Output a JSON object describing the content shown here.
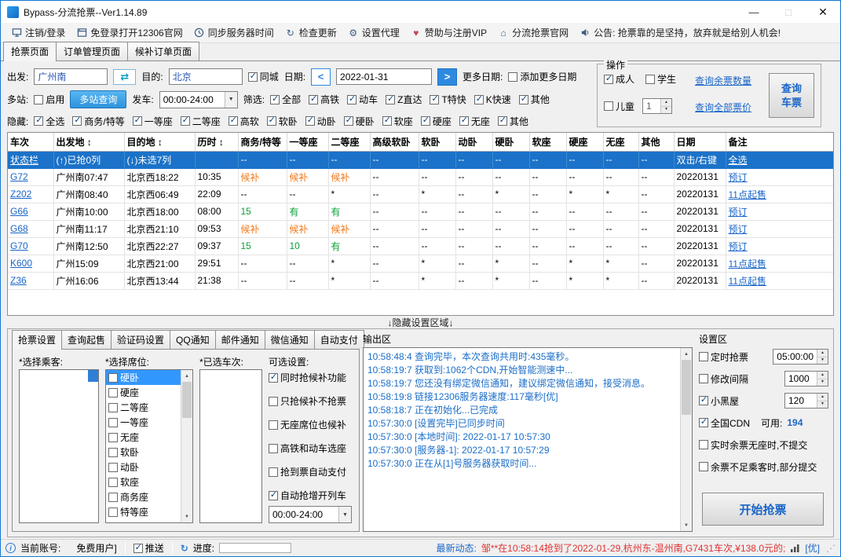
{
  "window": {
    "title": "Bypass-分流抢票--Ver1.14.89",
    "minimize": "—",
    "maximize": "□",
    "close": "✕"
  },
  "icons": {
    "swap": "⇄",
    "refresh": "↻",
    "proxy": "⚙",
    "heart": "♥",
    "home": "⌂",
    "progress": "↻",
    "info": "i",
    "date_prev": "<",
    "date_next": ">",
    "dropdown": "▼",
    "up": "▲",
    "down": "▼",
    "grip": "⋰"
  },
  "menubar": {
    "items": [
      {
        "icon": "computer-icon",
        "label": "注销/登录"
      },
      {
        "icon": "browser-icon",
        "label": "免登录打开12306官网"
      },
      {
        "icon": "clock-icon",
        "label": "同步服务器时间"
      },
      {
        "icon": "refresh-icon",
        "label": "检查更新"
      },
      {
        "icon": "proxy-icon",
        "label": "设置代理"
      },
      {
        "icon": "heart-icon",
        "label": "赞助与注册VIP"
      },
      {
        "icon": "home-icon",
        "label": "分流抢票官网"
      },
      {
        "icon": "announce-icon",
        "label": "公告: 抢票靠的是坚持，放弃就是给别人机会!"
      }
    ]
  },
  "main_tabs": [
    {
      "label": "抢票页面",
      "active": true
    },
    {
      "label": "订单管理页面",
      "active": false
    },
    {
      "label": "候补订单页面",
      "active": false
    }
  ],
  "query": {
    "depart_label": "出发:",
    "depart_value": "广州南",
    "dest_label": "目的:",
    "dest_value": "北京",
    "same_city": {
      "label": "同城",
      "checked": true
    },
    "date_label": "日期:",
    "date_value": "2022-01-31",
    "more_dates_label": "更多日期:",
    "add_more_dates": {
      "label": "添加更多日期",
      "checked": false
    },
    "multi_label": "多站:",
    "multi_enable": {
      "label": "启用",
      "checked": false
    },
    "multi_query_button": "多站查询",
    "depart_time_label": "发车:",
    "depart_time_value": "00:00-24:00",
    "filter_label": "筛选:",
    "filters": [
      {
        "label": "全部",
        "checked": true
      },
      {
        "label": "高铁",
        "checked": true
      },
      {
        "label": "动车",
        "checked": true
      },
      {
        "label": "Z直达",
        "checked": true
      },
      {
        "label": "T特快",
        "checked": true
      },
      {
        "label": "K快速",
        "checked": true
      },
      {
        "label": "其他",
        "checked": true
      }
    ],
    "hide_label": "隐藏:",
    "hide_options": [
      {
        "label": "全选",
        "checked": true
      },
      {
        "label": "商务/特等",
        "checked": true
      },
      {
        "label": "一等座",
        "checked": true
      },
      {
        "label": "二等座",
        "checked": true
      },
      {
        "label": "高软",
        "checked": true
      },
      {
        "label": "软卧",
        "checked": true
      },
      {
        "label": "动卧",
        "checked": true
      },
      {
        "label": "硬卧",
        "checked": true
      },
      {
        "label": "软座",
        "checked": true
      },
      {
        "label": "硬座",
        "checked": true
      },
      {
        "label": "无座",
        "checked": true
      },
      {
        "label": "其他",
        "checked": true
      }
    ]
  },
  "operation": {
    "group_label": "操作",
    "adult": {
      "label": "成人",
      "checked": true
    },
    "student": {
      "label": "学生",
      "checked": false
    },
    "child": {
      "label": "儿童",
      "checked": false
    },
    "child_count": "1",
    "link_query_count": "查询余票数量",
    "link_query_price": "查询全部票价",
    "query_button_line1": "查询",
    "query_button_line2": "车票"
  },
  "train_table": {
    "columns": [
      "车次",
      "出发地 ↕",
      "目的地 ↕",
      "历时 ↕",
      "商务/特等",
      "一等座",
      "二等座",
      "高级软卧",
      "软卧",
      "动卧",
      "硬卧",
      "软座",
      "硬座",
      "无座",
      "其他",
      "日期",
      "备注"
    ],
    "status_row": [
      [
        "状态栏",
        "wlink"
      ],
      "(↑)已抢0列",
      "(↓)未选7列",
      "",
      "--",
      "--",
      "--",
      "--",
      "--",
      "--",
      "--",
      "--",
      "--",
      "--",
      "--",
      "双击/右键",
      [
        "全选",
        "wlink"
      ]
    ],
    "rows": [
      [
        [
          "G72",
          "link"
        ],
        "广州南07:47",
        "北京西18:22",
        "10:35",
        [
          "候补",
          "wait"
        ],
        [
          "候补",
          "wait"
        ],
        [
          "候补",
          "wait"
        ],
        "--",
        "--",
        "--",
        "--",
        "--",
        "--",
        "--",
        "--",
        "20220131",
        [
          "预订",
          "link"
        ]
      ],
      [
        [
          "Z202",
          "link"
        ],
        "广州南08:40",
        "北京西06:49",
        "22:09",
        "--",
        "--",
        "*",
        "--",
        "*",
        "--",
        "*",
        "--",
        "*",
        "*",
        "--",
        "20220131",
        [
          "11点起售",
          "link"
        ]
      ],
      [
        [
          "G66",
          "link"
        ],
        "广州南10:00",
        "北京西18:00",
        "08:00",
        [
          "15",
          "ok"
        ],
        [
          "有",
          "ok"
        ],
        [
          "有",
          "ok"
        ],
        "--",
        "--",
        "--",
        "--",
        "--",
        "--",
        "--",
        "--",
        "20220131",
        [
          "预订",
          "link"
        ]
      ],
      [
        [
          "G68",
          "link"
        ],
        "广州南11:17",
        "北京西21:10",
        "09:53",
        [
          "候补",
          "wait"
        ],
        [
          "候补",
          "wait"
        ],
        [
          "候补",
          "wait"
        ],
        "--",
        "--",
        "--",
        "--",
        "--",
        "--",
        "--",
        "--",
        "20220131",
        [
          "预订",
          "link"
        ]
      ],
      [
        [
          "G70",
          "link"
        ],
        "广州南12:50",
        "北京西22:27",
        "09:37",
        [
          "15",
          "ok"
        ],
        [
          "10",
          "ok"
        ],
        [
          "有",
          "ok"
        ],
        "--",
        "--",
        "--",
        "--",
        "--",
        "--",
        "--",
        "--",
        "20220131",
        [
          "预订",
          "link"
        ]
      ],
      [
        [
          "K600",
          "link"
        ],
        "广州15:09",
        "北京西21:00",
        "29:51",
        "--",
        "--",
        "*",
        "--",
        "*",
        "--",
        "*",
        "--",
        "*",
        "*",
        "--",
        "20220131",
        [
          "11点起售",
          "link"
        ]
      ],
      [
        [
          "Z36",
          "link"
        ],
        "广州16:06",
        "北京西13:44",
        "21:38",
        "--",
        "--",
        "*",
        "--",
        "*",
        "--",
        "*",
        "--",
        "*",
        "*",
        "--",
        "20220131",
        [
          "11点起售",
          "link"
        ]
      ]
    ]
  },
  "hide_divider": "↓隐藏设置区域↓",
  "grab_settings": {
    "tabs": [
      {
        "label": "抢票设置",
        "active": true
      },
      {
        "label": "查询起售",
        "active": false
      },
      {
        "label": "验证码设置",
        "active": false
      },
      {
        "label": "QQ通知",
        "active": false
      },
      {
        "label": "邮件通知",
        "active": false
      },
      {
        "label": "微信通知",
        "active": false
      },
      {
        "label": "自动支付",
        "active": false
      }
    ],
    "passengers_label": "*选择乘客:",
    "seats_label": "*选择席位:",
    "trains_label": "*已选车次:",
    "options_label": "可选设置:",
    "seats": [
      {
        "label": "硬卧",
        "checked": false,
        "selected": true
      },
      {
        "label": "硬座",
        "checked": false
      },
      {
        "label": "二等座",
        "checked": false
      },
      {
        "label": "一等座",
        "checked": false
      },
      {
        "label": "无座",
        "checked": false
      },
      {
        "label": "软卧",
        "checked": false
      },
      {
        "label": "动卧",
        "checked": false
      },
      {
        "label": "软座",
        "checked": false
      },
      {
        "label": "商务座",
        "checked": false
      },
      {
        "label": "特等座",
        "checked": false
      }
    ],
    "options": [
      {
        "label": "同时抢候补功能",
        "checked": true
      },
      {
        "label": "只抢候补不抢票",
        "checked": false
      },
      {
        "label": "无座席位也候补",
        "checked": false
      },
      {
        "label": "高铁和动车选座",
        "checked": false
      },
      {
        "label": "抢到票自动支付",
        "checked": false
      },
      {
        "label": "自动抢增开列车",
        "checked": true
      }
    ],
    "depart_time_value": "00:00-24:00"
  },
  "output": {
    "label": "输出区",
    "lines": [
      "10:58:48:4  查询完毕，本次查询共用时:435毫秒。",
      "10:58:19:7  获取到:1062个CDN,开始智能测速中...",
      "10:58:19:7  您还没有绑定微信通知，建议绑定微信通知，接受消息。",
      "10:58:19:8  链接12306服务器速度:117毫秒[优]",
      "10:58:18:7  正在初始化...已完成",
      "10:57:30:0  [设置完毕]已同步时间",
      "10:57:30:0  [本地时间]: 2022-01-17 10:57:30",
      "10:57:30:0  [服务器-1]:  2022-01-17 10:57:29",
      "10:57:30:0  正在从[1]号服务器获取时间..."
    ]
  },
  "settings_area": {
    "label": "设置区",
    "timed": {
      "label": "定时抢票",
      "checked": false,
      "value": "05:00:00"
    },
    "interval": {
      "label": "修改间隔",
      "checked": false,
      "value": "1000"
    },
    "blacklist": {
      "label": "小黑屋",
      "checked": true,
      "value": "120"
    },
    "cdn": {
      "label": "全国CDN",
      "checked": true,
      "avail_label": "可用:",
      "avail_value": "194"
    },
    "no_seat": {
      "label": "实时余票无座时,不提交",
      "checked": false
    },
    "partial": {
      "label": "余票不足乘客时,部分提交",
      "checked": false
    },
    "start_button": "开始抢票"
  },
  "statusbar": {
    "account_label": "当前账号:",
    "account_value": "免费用户]",
    "push": {
      "label": "推送",
      "checked": true
    },
    "progress_label": "进度:",
    "news_label": "最新动态:",
    "news_text": "邹**在10:58:14抢到了2022-01-29,杭州东-温州南,G7431车次,¥138.0元的;",
    "signal_quality": "[优]"
  }
}
